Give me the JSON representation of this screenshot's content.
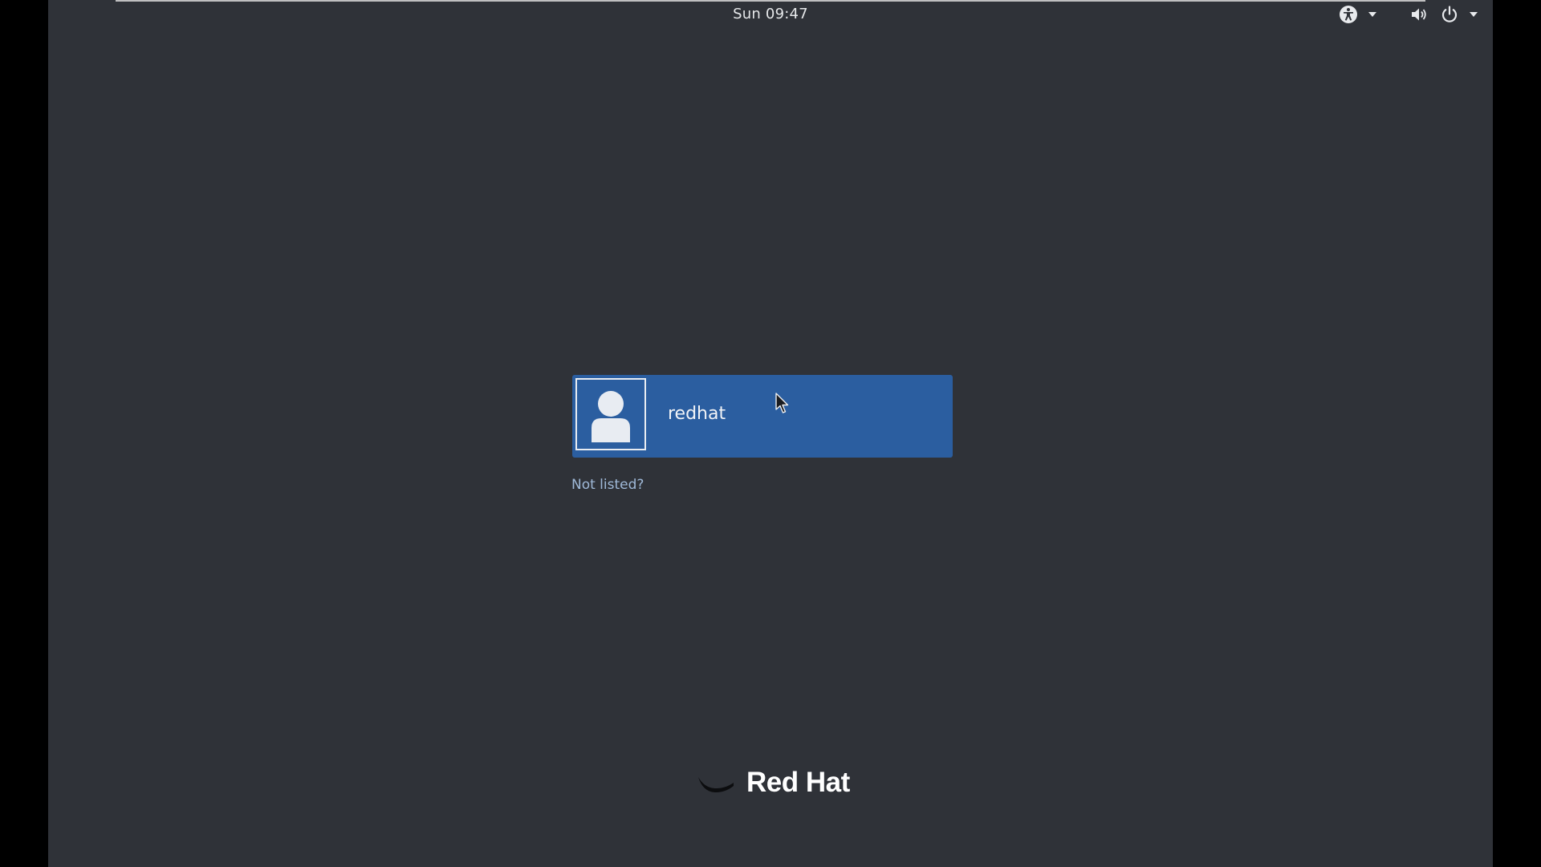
{
  "top_bar": {
    "clock": "Sun 09:47",
    "accessibility_menu": {
      "icon": "accessibility-icon",
      "caret_icon": "caret-down-icon"
    },
    "volume": {
      "icon": "volume-icon"
    },
    "power_menu": {
      "icon": "power-icon",
      "caret_icon": "caret-down-icon"
    }
  },
  "login": {
    "users": [
      {
        "name": "redhat",
        "avatar_icon": "user-silhouette-icon",
        "selected": true
      }
    ],
    "not_listed_link": "Not listed?"
  },
  "branding": {
    "logo_text": "Red Hat"
  },
  "colors": {
    "background": "#2f3238",
    "user_card": "#2b5ea0",
    "link": "#9fb9d8",
    "text": "#e6e8ea"
  }
}
